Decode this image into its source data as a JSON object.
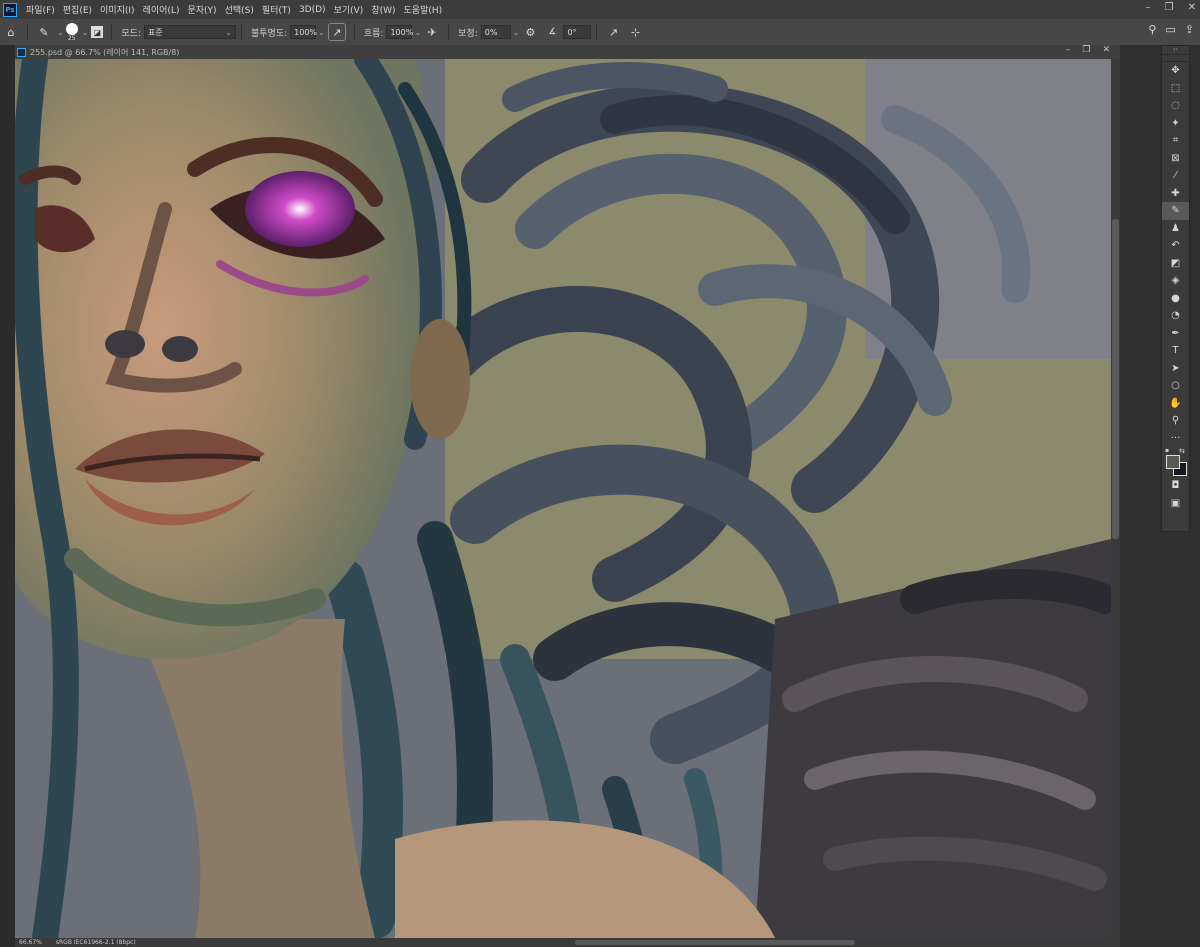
{
  "menubar": {
    "items": [
      "파일(F)",
      "편집(E)",
      "이미지(I)",
      "레이어(L)",
      "문자(Y)",
      "선택(S)",
      "필터(T)",
      "3D(D)",
      "보기(V)",
      "창(W)",
      "도움말(H)"
    ],
    "logo": "Ps"
  },
  "options": {
    "brush_size": "25",
    "mode_label": "모드:",
    "mode_value": "표준",
    "opacity_label": "불투명도:",
    "opacity_value": "100%",
    "flow_label": "흐름:",
    "flow_value": "100%",
    "smoothing_label": "보정:",
    "smoothing_value": "0%",
    "angle_value": "0°"
  },
  "document": {
    "tab_title": "255.psd @ 66.7% (레이어 141, RGB/8)"
  },
  "status": {
    "zoom": "66.67%",
    "profile": "sRGB IEC61966-2.1 (8bpc)"
  },
  "tools": {
    "header": "‹‹",
    "items": [
      {
        "name": "move-tool",
        "glyph": "✥"
      },
      {
        "name": "marquee-tool",
        "glyph": "⬚"
      },
      {
        "name": "lasso-tool",
        "glyph": "◌"
      },
      {
        "name": "magic-wand-tool",
        "glyph": "✦"
      },
      {
        "name": "crop-tool",
        "glyph": "⌗"
      },
      {
        "name": "frame-tool",
        "glyph": "⊠"
      },
      {
        "name": "eyedropper-tool",
        "glyph": "⁄"
      },
      {
        "name": "healing-brush-tool",
        "glyph": "✚"
      },
      {
        "name": "brush-tool",
        "glyph": "✎",
        "active": true
      },
      {
        "name": "clone-stamp-tool",
        "glyph": "♟"
      },
      {
        "name": "history-brush-tool",
        "glyph": "↶"
      },
      {
        "name": "eraser-tool",
        "glyph": "◩"
      },
      {
        "name": "paint-bucket-tool",
        "glyph": "◈"
      },
      {
        "name": "blur-tool",
        "glyph": "●"
      },
      {
        "name": "dodge-tool",
        "glyph": "◔"
      },
      {
        "name": "pen-tool",
        "glyph": "✒"
      },
      {
        "name": "type-tool",
        "glyph": "T"
      },
      {
        "name": "path-selection-tool",
        "glyph": "➤"
      },
      {
        "name": "ellipse-tool",
        "glyph": "○"
      },
      {
        "name": "hand-tool",
        "glyph": "✋"
      },
      {
        "name": "zoom-tool",
        "glyph": "⚲"
      },
      {
        "name": "more-tools",
        "glyph": "···"
      }
    ]
  },
  "colors": {
    "foreground": "#565a53",
    "background": "#151b20",
    "accent": "#31a8ff"
  }
}
